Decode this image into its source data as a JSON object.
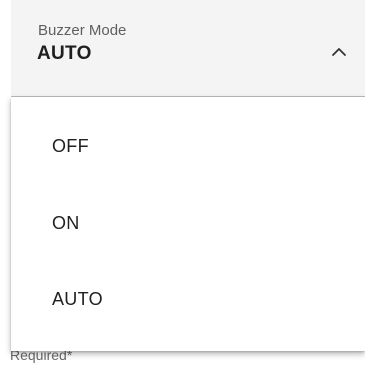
{
  "select": {
    "label": "Buzzer Mode",
    "value": "AUTO",
    "expanded": true,
    "chevron_icon": "chevron-up-icon",
    "helper_text": "Required*"
  },
  "menu": {
    "options": [
      {
        "label": "OFF"
      },
      {
        "label": "ON"
      },
      {
        "label": "AUTO"
      }
    ]
  },
  "colors": {
    "field_background": "#f4f4f4",
    "menu_background": "#ffffff",
    "text_primary": "#1f1f1f",
    "text_secondary": "#5f5f5f"
  }
}
